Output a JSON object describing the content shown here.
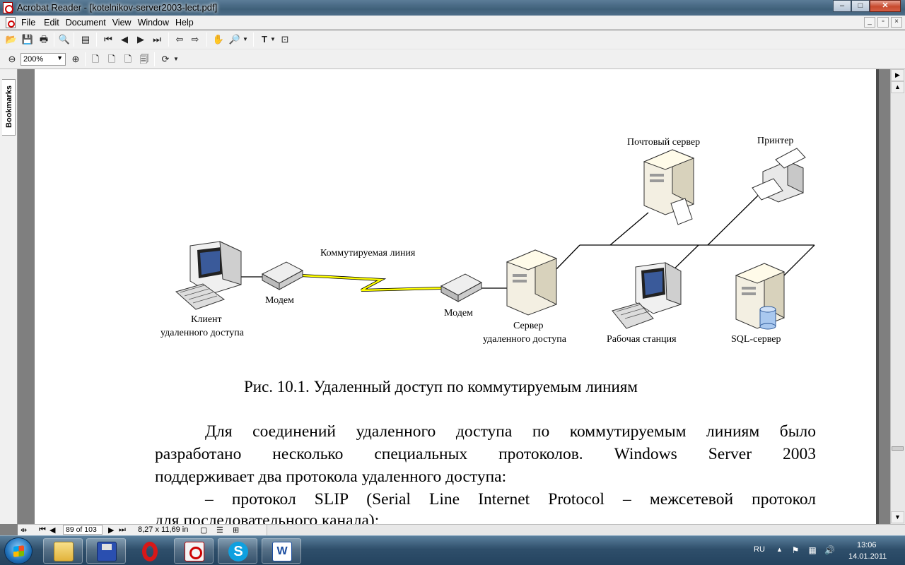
{
  "window": {
    "title": "Acrobat Reader - [kotelnikov-server2003-lect.pdf]",
    "controls": {
      "minimize": "–",
      "maximize": "□",
      "close": "✕"
    }
  },
  "menu": {
    "items": [
      "File",
      "Edit",
      "Document",
      "View",
      "Window",
      "Help"
    ],
    "mdi_controls": [
      "_",
      "▫",
      "×"
    ]
  },
  "toolbar": {
    "zoom_value": "200%"
  },
  "side_panel": {
    "bookmarks_tab": "Bookmarks"
  },
  "document": {
    "figure": {
      "labels": {
        "mail_server": "Почтовый сервер",
        "printer": "Принтер",
        "switched_line": "Коммутируемая линия",
        "modem_left": "Модем",
        "modem_right": "Модем",
        "client_line1": "Клиент",
        "client_line2": "удаленного доступа",
        "server_line1": "Сервер",
        "server_line2": "удаленного доступа",
        "workstation": "Рабочая станция",
        "sql_server": "SQL-сервер"
      },
      "caption": "Рис. 10.1. Удаленный доступ по коммутируемым линиям"
    },
    "paragraph": {
      "line1": "Для соединений удаленного доступа по коммутируемым линиям было",
      "line2": "разработано несколько специальных протоколов. Windows Server 2003",
      "line3": "поддерживает два протокола удаленного доступа:",
      "line4": "–   протокол SLIP (Serial Line Internet Protocol – межсетевой протокол",
      "line5": "для последовательного канала);"
    }
  },
  "status": {
    "page": "89 of 103",
    "page_size": "8,27 x 11,69 in"
  },
  "taskbar": {
    "language": "RU",
    "time": "13:06",
    "date": "14.01.2011"
  }
}
